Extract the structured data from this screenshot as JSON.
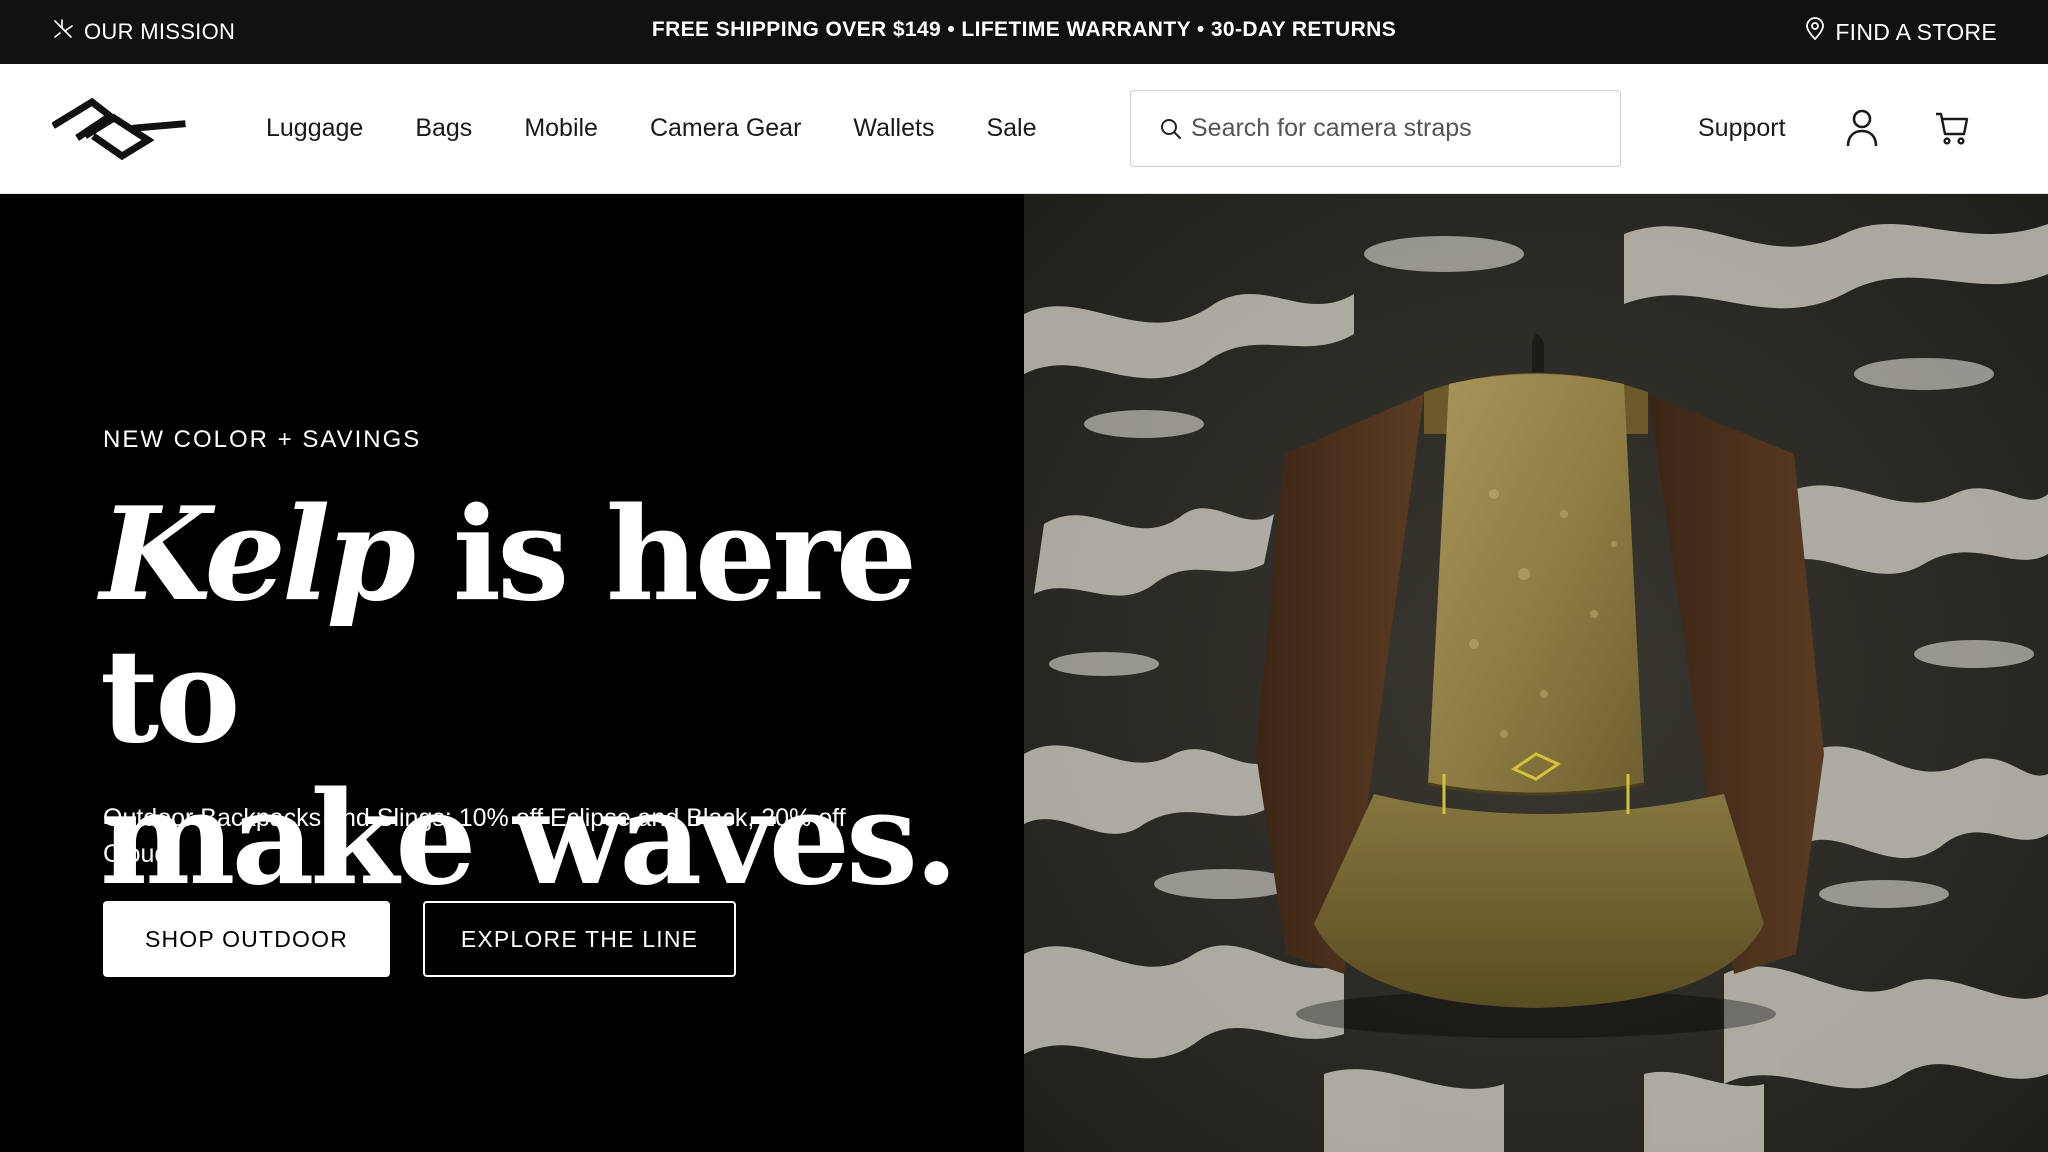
{
  "announcement": {
    "left_label": "OUR MISSION",
    "center_text": "FREE SHIPPING OVER $149 • LIFETIME WARRANTY • 30-DAY RETURNS",
    "right_label": "FIND A STORE"
  },
  "nav": {
    "items": [
      {
        "label": "Luggage"
      },
      {
        "label": "Bags"
      },
      {
        "label": "Mobile"
      },
      {
        "label": "Camera Gear"
      },
      {
        "label": "Wallets"
      },
      {
        "label": "Sale"
      }
    ],
    "search_placeholder": "Search for camera straps",
    "support_label": "Support"
  },
  "hero": {
    "eyebrow": "NEW COLOR + SAVINGS",
    "headline_italic": "Kelp",
    "headline_line1_rest": " is here to",
    "headline_line2": "make waves.",
    "subcopy": "Outdoor Backpacks and Slings: 10% off Eclipse and Black, 20% off Cloud.",
    "primary_button": "SHOP OUTDOOR",
    "secondary_button": "EXPLORE THE LINE"
  },
  "icons": {
    "mission": "leaf-icon",
    "store": "map-pin-icon",
    "search": "search-icon",
    "account": "user-icon",
    "cart": "cart-icon",
    "logo": "brand-logo"
  },
  "colors": {
    "topbar_bg": "#111111",
    "header_bg": "#ffffff",
    "hero_bg": "#000000",
    "backpack_kelp": "#8a7a3e"
  }
}
